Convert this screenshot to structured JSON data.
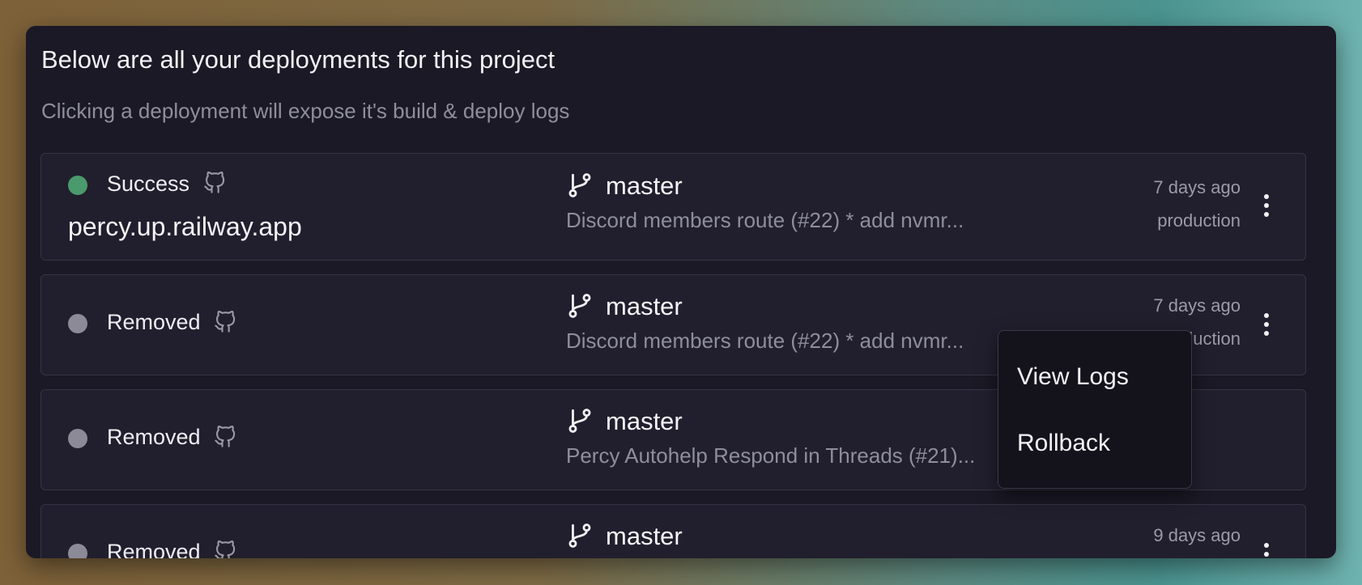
{
  "page": {
    "heading": "Below are all your deployments for this project",
    "subheading": "Clicking a deployment will expose it's build & deploy logs"
  },
  "colors": {
    "success": "#4a9a6e",
    "removed": "#8b8a96",
    "panel": "#1a1925",
    "row": "#211f2d"
  },
  "deployments": [
    {
      "status": "Success",
      "status_color": "#4a9a6e",
      "domain": "percy.up.railway.app",
      "branch": "master",
      "commit": "Discord members route (#22) * add nvmr...",
      "time": "7 days ago",
      "environment": "production"
    },
    {
      "status": "Removed",
      "status_color": "#8b8a96",
      "branch": "master",
      "commit": "Discord members route (#22) * add nvmr...",
      "time": "7 days ago",
      "environment": "production"
    },
    {
      "status": "Removed",
      "status_color": "#8b8a96",
      "branch": "master",
      "commit": "Percy Autohelp Respond in Threads (#21)..."
    },
    {
      "status": "Removed",
      "status_color": "#8b8a96",
      "branch": "master",
      "time": "9 days ago"
    }
  ],
  "context_menu": {
    "items": [
      "View Logs",
      "Rollback"
    ]
  },
  "icons": {
    "github": "github-icon",
    "branch": "git-branch-icon",
    "more": "more-vertical-icon"
  }
}
